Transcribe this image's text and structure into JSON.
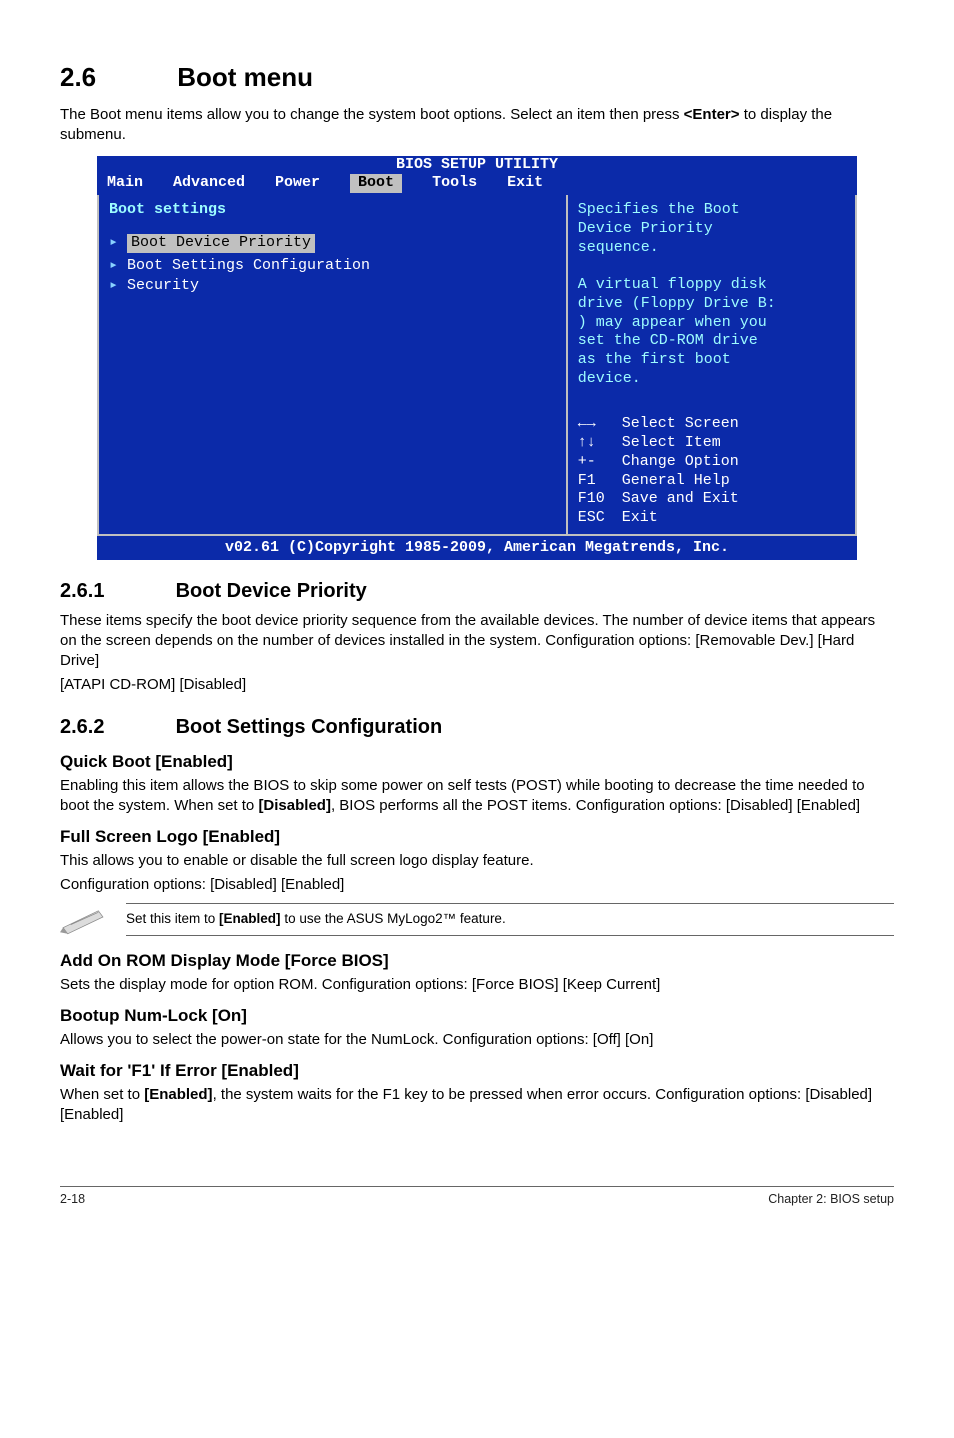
{
  "section": {
    "number": "2.6",
    "title": "Boot menu",
    "intro_pre": "The Boot menu items allow you to change the system boot options. Select an item then press ",
    "intro_bold": "<Enter>",
    "intro_post": " to display the submenu."
  },
  "bios": {
    "title": "BIOS SETUP UTILITY",
    "tabs": [
      "Main",
      "Advanced",
      "Power",
      "Boot",
      "Tools",
      "Exit"
    ],
    "active_tab_index": 3,
    "panel_title": "Boot settings",
    "items": [
      {
        "label": "Boot Device Priority",
        "selected": true
      },
      {
        "label": "Boot Settings Configuration",
        "selected": false
      },
      {
        "label": "Security",
        "selected": false
      }
    ],
    "right_help_lines": [
      "Specifies the Boot",
      "Device Priority",
      "sequence.",
      "",
      "A virtual floppy disk",
      "drive (Floppy Drive B:",
      ") may appear when you",
      "set the CD-ROM drive",
      "as the first boot",
      "device."
    ],
    "fn_keys": [
      {
        "key": "←→",
        "desc": "Select Screen"
      },
      {
        "key": "↑↓",
        "desc": "Select Item"
      },
      {
        "key": "+-",
        "desc": "Change Option"
      },
      {
        "key": "F1",
        "desc": "General Help"
      },
      {
        "key": "F10",
        "desc": "Save and Exit"
      },
      {
        "key": "ESC",
        "desc": "Exit"
      }
    ],
    "footer": "v02.61 (C)Copyright 1985-2009, American Megatrends, Inc."
  },
  "sub261": {
    "number": "2.6.1",
    "title": "Boot Device Priority",
    "p1": "These items specify the boot device priority sequence from the available devices. The number of device items that appears on the screen depends on the number of devices installed in the system. Configuration options: [Removable Dev.] [Hard Drive]",
    "p2": "[ATAPI CD-ROM] [Disabled]"
  },
  "sub262": {
    "number": "2.6.2",
    "title": "Boot Settings Configuration",
    "quick_boot": {
      "heading": "Quick Boot [Enabled]",
      "p_pre": "Enabling this item allows the BIOS to skip some power on self tests (POST) while booting to decrease the time needed to boot the system. When set to ",
      "p_bold": "[Disabled]",
      "p_post": ", BIOS performs all the POST items. Configuration options: [Disabled] [Enabled]"
    },
    "full_screen_logo": {
      "heading": "Full Screen Logo [Enabled]",
      "p1": "This allows you to enable or disable the full screen logo display feature.",
      "p2": "Configuration options: [Disabled] [Enabled]"
    },
    "note": {
      "pre": "Set this item to ",
      "bold": "[Enabled]",
      "post": " to use the ASUS MyLogo2™ feature."
    },
    "add_on_rom": {
      "heading": "Add On ROM Display Mode [Force BIOS]",
      "p": "Sets the display mode for option ROM. Configuration options: [Force BIOS] [Keep Current]"
    },
    "numlock": {
      "heading": "Bootup Num-Lock [On]",
      "p": "Allows you to select the power-on state for the NumLock. Configuration options: [Off] [On]"
    },
    "wait_f1": {
      "heading": "Wait for 'F1' If Error [Enabled]",
      "p_pre": "When set to ",
      "p_bold": "[Enabled]",
      "p_post": ", the system waits for the F1 key to be pressed when error occurs. Configuration options: [Disabled] [Enabled]"
    }
  },
  "footer": {
    "left": "2-18",
    "right": "Chapter 2: BIOS setup"
  }
}
